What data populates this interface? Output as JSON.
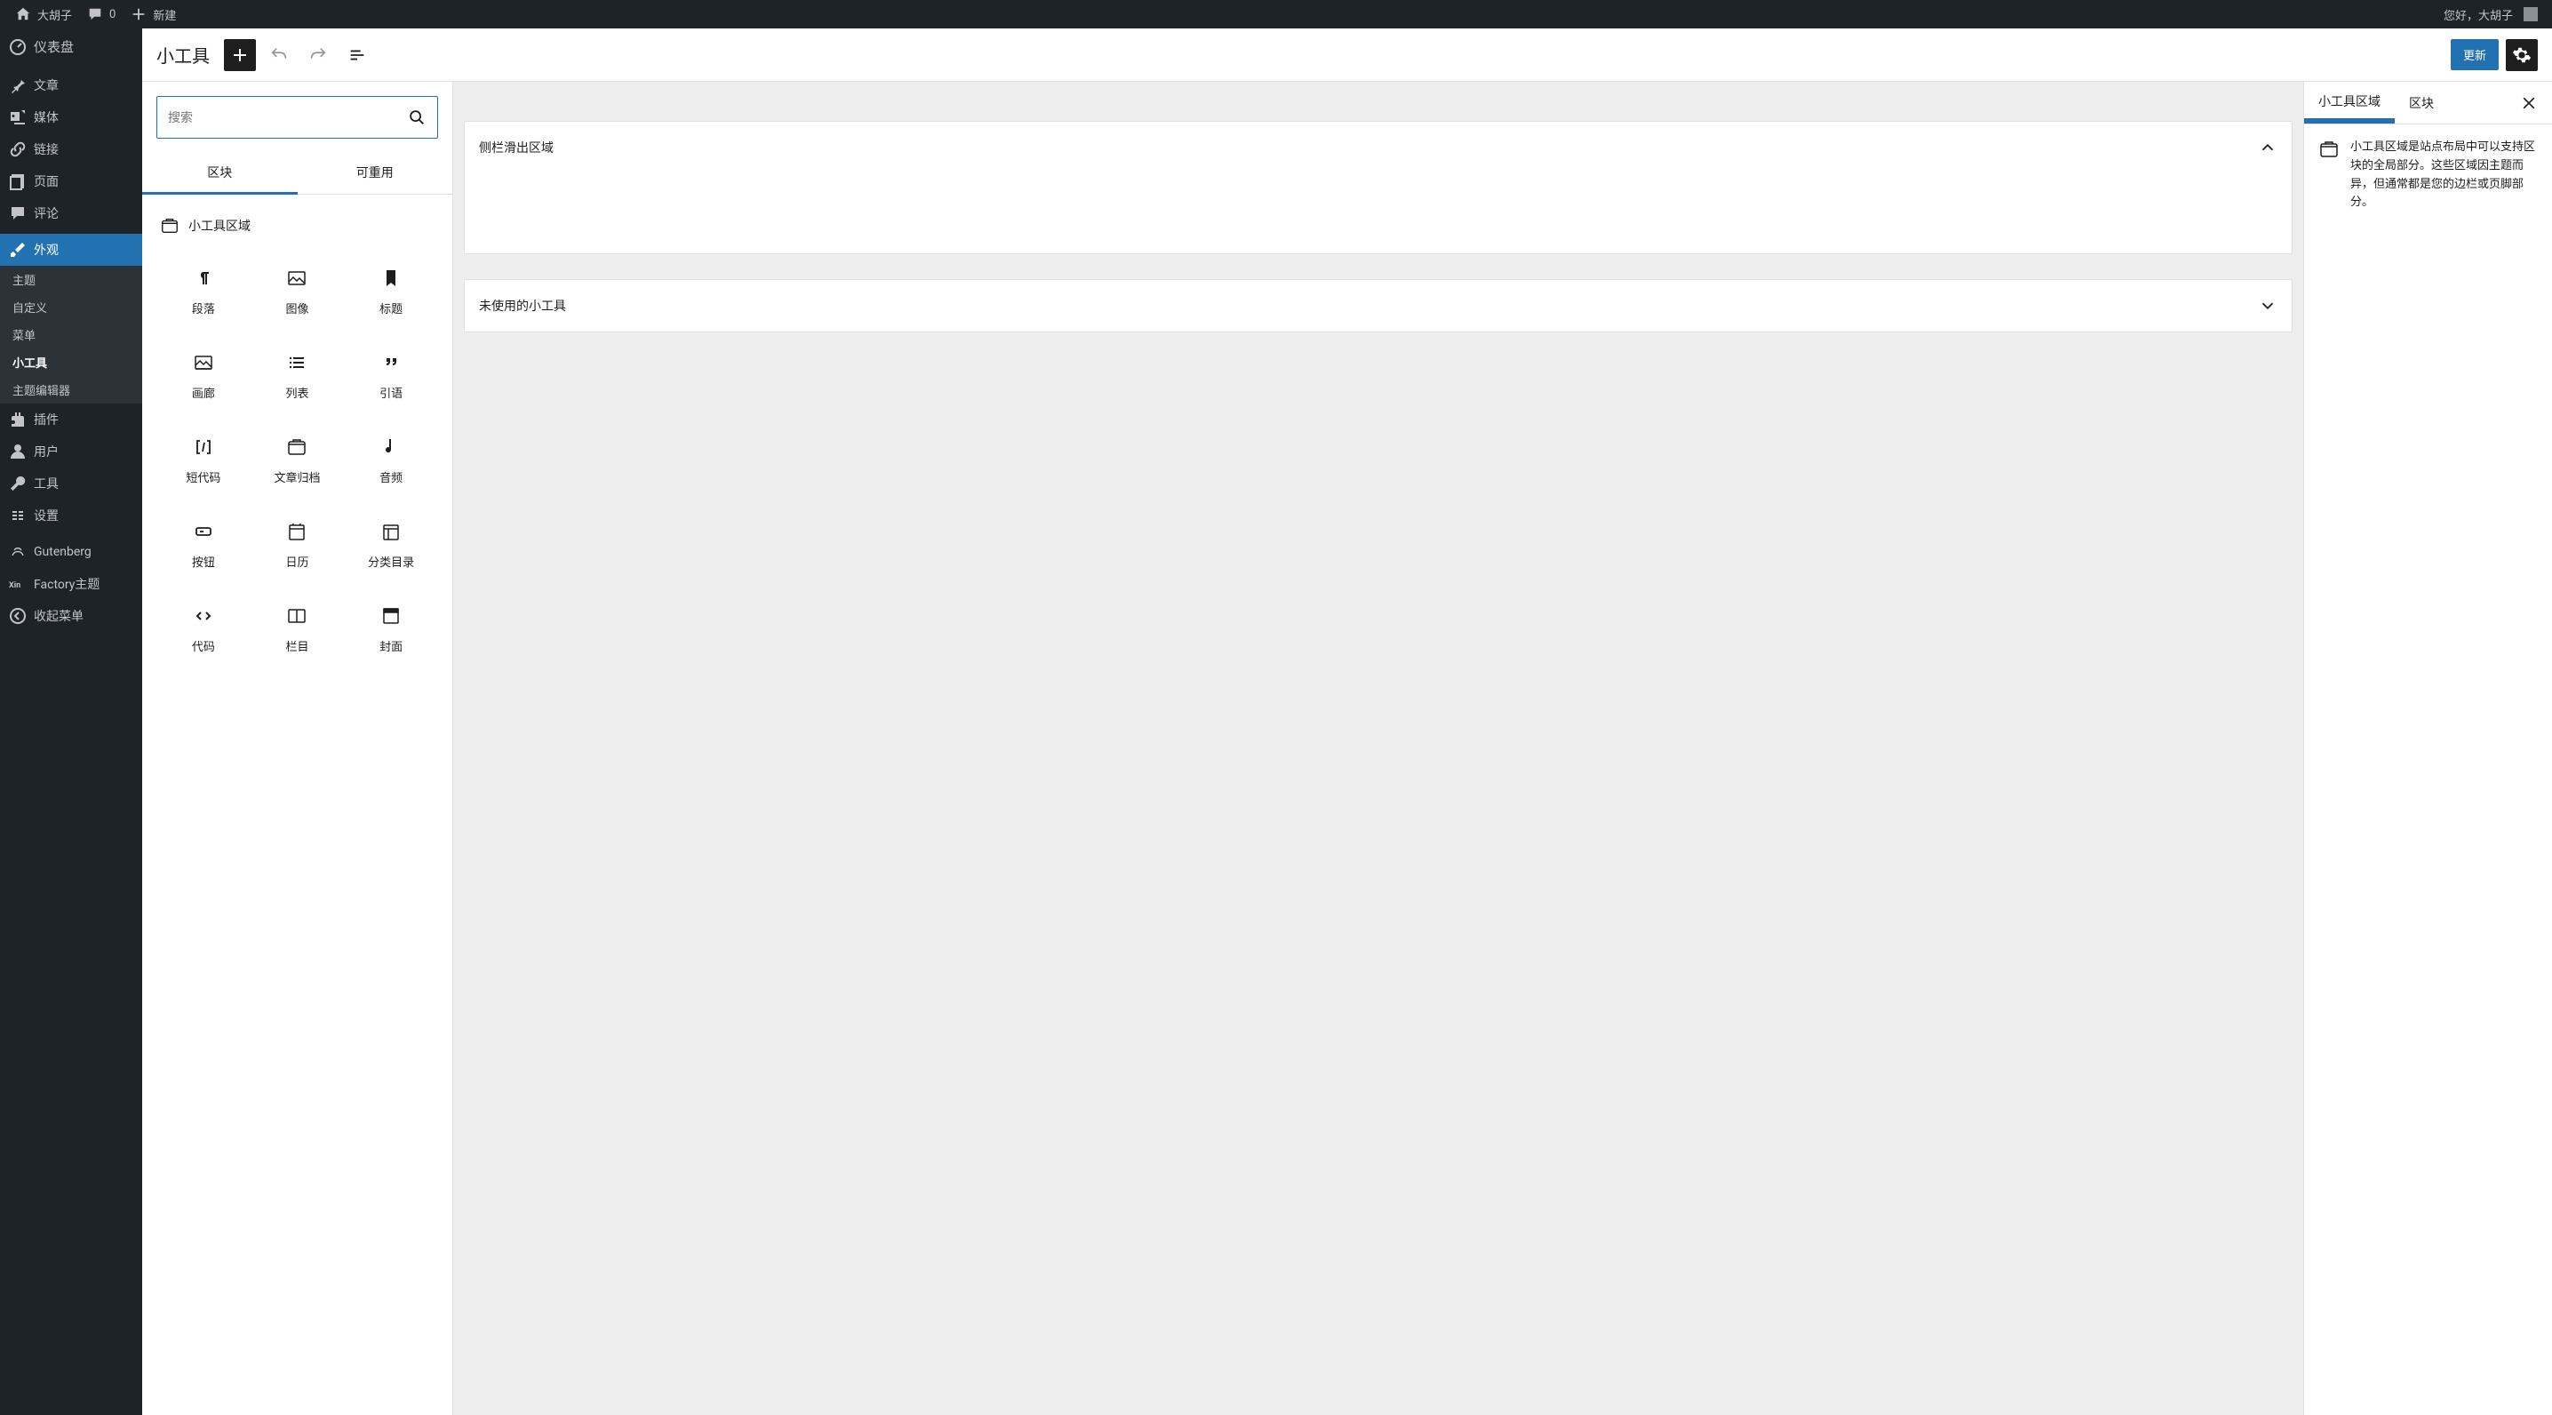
{
  "adminbar": {
    "site_name": "大胡子",
    "comments_count": "0",
    "new_label": "新建",
    "greeting": "您好，大胡子"
  },
  "sidebar": {
    "items": [
      {
        "label": "仪表盘",
        "icon": "dashboard"
      },
      {
        "label": "文章",
        "icon": "pin"
      },
      {
        "label": "媒体",
        "icon": "media"
      },
      {
        "label": "链接",
        "icon": "link"
      },
      {
        "label": "页面",
        "icon": "page"
      },
      {
        "label": "评论",
        "icon": "comment"
      },
      {
        "label": "外观",
        "icon": "brush",
        "current": true
      },
      {
        "label": "插件",
        "icon": "plugin"
      },
      {
        "label": "用户",
        "icon": "user"
      },
      {
        "label": "工具",
        "icon": "wrench"
      },
      {
        "label": "设置",
        "icon": "settings"
      },
      {
        "label": "Gutenberg",
        "icon": "gutenberg"
      },
      {
        "label": "Factory主题",
        "icon": "factory"
      },
      {
        "label": "收起菜单",
        "icon": "collapse"
      }
    ],
    "submenu": [
      {
        "label": "主题"
      },
      {
        "label": "自定义"
      },
      {
        "label": "菜单"
      },
      {
        "label": "小工具",
        "current": true
      },
      {
        "label": "主题编辑器"
      }
    ]
  },
  "header": {
    "title": "小工具",
    "update_label": "更新"
  },
  "inserter": {
    "search_placeholder": "搜索",
    "tabs": [
      {
        "label": "区块",
        "active": true
      },
      {
        "label": "可重用"
      }
    ],
    "category_label": "小工具区域",
    "blocks": [
      {
        "label": "段落",
        "icon": "paragraph"
      },
      {
        "label": "图像",
        "icon": "image"
      },
      {
        "label": "标题",
        "icon": "bookmark"
      },
      {
        "label": "画廊",
        "icon": "gallery"
      },
      {
        "label": "列表",
        "icon": "list"
      },
      {
        "label": "引语",
        "icon": "quote"
      },
      {
        "label": "短代码",
        "icon": "shortcode"
      },
      {
        "label": "文章归档",
        "icon": "archive"
      },
      {
        "label": "音频",
        "icon": "audio"
      },
      {
        "label": "按钮",
        "icon": "button"
      },
      {
        "label": "日历",
        "icon": "calendar"
      },
      {
        "label": "分类目录",
        "icon": "categories"
      },
      {
        "label": "代码",
        "icon": "code"
      },
      {
        "label": "栏目",
        "icon": "columns"
      },
      {
        "label": "封面",
        "icon": "cover"
      }
    ]
  },
  "canvas": {
    "areas": [
      {
        "label": "侧栏滑出区域",
        "expanded": true
      },
      {
        "label": "未使用的小工具",
        "expanded": false
      }
    ]
  },
  "settings": {
    "tabs": [
      {
        "label": "小工具区域",
        "active": true
      },
      {
        "label": "区块"
      }
    ],
    "description": "小工具区域是站点布局中可以支持区块的全局部分。这些区域因主题而异，但通常都是您的边栏或页脚部分。"
  }
}
